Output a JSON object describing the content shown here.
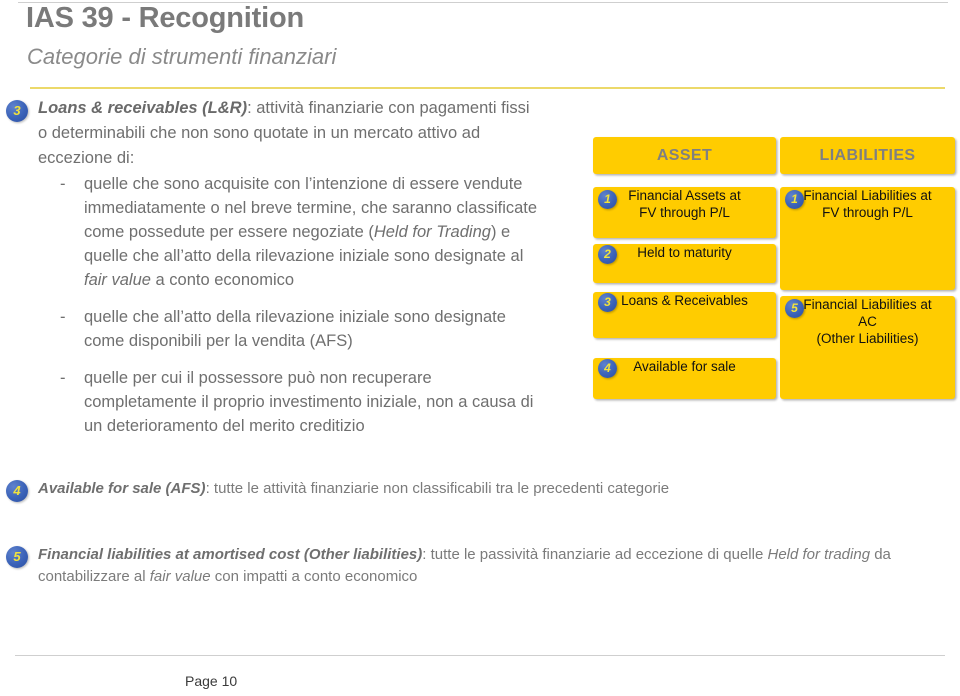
{
  "slide": {
    "title": "IAS 39 - Recognition",
    "subtitle": "Categorie di strumenti finanziari",
    "footer_page": "Page 10"
  },
  "colors": {
    "accent_yellow": "#ffcc00",
    "rule_yellow": "#ecd96a",
    "badge_blue": "#3a62b8",
    "badge_number": "#f2e33c",
    "body_gray": "#6f6f6f",
    "heading_gray": "#7a7a7a"
  },
  "lead": {
    "badge": "3",
    "term": "Loans & receivables (L&R)",
    "text": ": attività finanziarie con pagamenti fissi o determinabili che non sono quotate in un mercato attivo ad eccezione di:"
  },
  "sublist": [
    {
      "dash": "-",
      "parts": [
        {
          "text": "quelle che sono acquisite con l’intenzione di essere vendute immediatamente o nel breve termine, che saranno classificate come possedute per essere negoziate (",
          "italic": false
        },
        {
          "text": "Held for Trading",
          "italic": true
        },
        {
          "text": ") e quelle che all’atto della rilevazione iniziale sono designate al ",
          "italic": false
        },
        {
          "text": "fair value",
          "italic": true
        },
        {
          "text": " a conto economico",
          "italic": false
        }
      ]
    },
    {
      "dash": "-",
      "parts": [
        {
          "text": "quelle che all’atto della rilevazione iniziale sono designate come disponibili per la vendita (AFS)",
          "italic": false
        }
      ]
    },
    {
      "dash": "-",
      "parts": [
        {
          "text": "quelle per cui il possessore può non recuperare completamente il proprio investimento iniziale, non a causa di un deterioramento del merito creditizio",
          "italic": false
        }
      ]
    }
  ],
  "diagram": {
    "asset_header": "ASSET",
    "liabilities_header": "LIABILITIES",
    "asset_boxes": [
      {
        "num": "1",
        "lines": [
          "Financial Assets at",
          "FV through P/L"
        ]
      },
      {
        "num": "2",
        "lines": [
          "Held to maturity"
        ]
      },
      {
        "num": "3",
        "lines": [
          "Loans & Receivables"
        ]
      },
      {
        "num": "4",
        "lines": [
          "Available for sale"
        ]
      }
    ],
    "liability_boxes": [
      {
        "num": "1",
        "lines": [
          "Financial Liabilities at",
          "FV through P/L"
        ]
      },
      {
        "num": "5",
        "lines": [
          "Financial Liabilities at",
          "AC",
          "(Other Liabilities)"
        ]
      }
    ]
  },
  "bottom": [
    {
      "badge": "4",
      "term": "Available for sale (AFS)",
      "rest": ": tutte le attività finanziarie non classificabili tra le precedenti categorie"
    },
    {
      "badge": "5",
      "term": "Financial liabilities at amortised cost (Other liabilities)",
      "rest": ": tutte le passività finanziarie ad eccezione di quelle ",
      "italic1": "Held for trading",
      "rest2": " da contabilizzare al ",
      "italic2": "fair value",
      "rest3": " con impatti a conto economico"
    }
  ]
}
